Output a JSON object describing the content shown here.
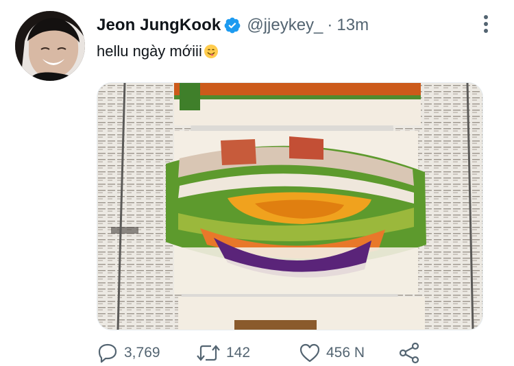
{
  "tweet": {
    "author_name": "Jeon JungKook",
    "handle": "@jjeykey_",
    "separator": "·",
    "time": "13m",
    "text": "hellu ngày mớiii",
    "emoji": "smiling-face-icon"
  },
  "actions": {
    "replies": "3,769",
    "retweets": "142",
    "likes": "456 N"
  },
  "icons": {
    "verified": "verified-badge-icon",
    "more": "more-options-icon",
    "reply": "reply-icon",
    "retweet": "retweet-icon",
    "like": "heart-icon",
    "share": "share-icon"
  },
  "colors": {
    "verified_blue": "#1d9bf0",
    "muted_text": "#536471",
    "primary_text": "#0f1419"
  }
}
